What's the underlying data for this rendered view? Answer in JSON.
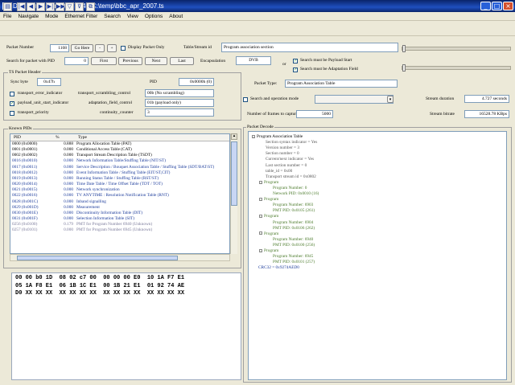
{
  "window": {
    "title": "DVB Translator 2009 V14 - C:\\temp\\bbc_apr_2007.ts",
    "icon_label": "DVB",
    "minimize": "_",
    "maximize": "□",
    "close": "×"
  },
  "menu": [
    "File",
    "Navigate",
    "Mode",
    "Ethernet Filter",
    "Search",
    "View",
    "Options",
    "About"
  ],
  "toolbar": {
    "icons": [
      "open-folder-icon",
      "first-icon",
      "prev-icon",
      "play-icon",
      "next-icon",
      "last-icon",
      "filter-icon",
      "filter-clear-icon",
      "copy-icon"
    ],
    "glyphs": [
      "▤",
      "|◀",
      "◀",
      "▶",
      "▶|",
      "▶▶|",
      "▽",
      "⊽",
      "⧉"
    ]
  },
  "packet_nav": {
    "packet_number_label": "Packet Number",
    "packet_number_value": "1108",
    "go_here_label": "Go Here",
    "minus_label": "-",
    "plus_label": "+",
    "display_packet_only_label": "Display Packet Only",
    "table_stream_id_label": "Table/Stream id",
    "table_stream_id_value": "Program association section",
    "search_pid_label": "Search for packet with PID",
    "search_pid_value": "0",
    "first_label": "First",
    "previous_label": "Previous",
    "next_label": "Next",
    "last_label": "Last",
    "encapsulation_label": "Encapsulation",
    "encapsulation_value": "DVB",
    "or_label": "or",
    "payload_start_label": "Search must be Payload Start",
    "adaptation_field_label": "Search must be Adaptation Field"
  },
  "ts_header": {
    "title": "TS Packet Header",
    "sync_byte_label": "Sync byte",
    "sync_byte_value": "0x47h",
    "pid_label": "PID",
    "pid_value": "0x0000h (0)",
    "transport_error_label": "transport_error_indicator",
    "scrambling_label": "transport_scrambling_control",
    "scrambling_value": "00b (No scrambling)",
    "payload_start_label": "payload_unit_start_indicator",
    "adaptation_label": "adaptation_field_control",
    "adaptation_value": "01b (payload only)",
    "priority_label": "transport_priority",
    "continuity_label": "continuity_counter",
    "continuity_value": "3"
  },
  "packet_type": {
    "label": "Packet Type:",
    "value": "Program Association Table"
  },
  "search_mode": {
    "label": "Search and operation mode",
    "frames_label": "Number of frames to capture",
    "frames_value": "5000",
    "stream_duration_label": "Stream duration",
    "stream_duration_value": "4.727 seconds",
    "stream_bitrate_label": "Stream bitrate",
    "stream_bitrate_value": "16528.78 KBps"
  },
  "known_pids": {
    "title": "Known PIDs",
    "columns": [
      "PID",
      "%",
      "Type"
    ],
    "rows": [
      {
        "pid": "0000 (0x0000)",
        "pct": "0.888",
        "type": "Program Allocation Table (PAT)"
      },
      {
        "pid": "0001 (0x0001)",
        "pct": "0.000",
        "type": "Conditional Access Table (CAT)"
      },
      {
        "pid": "0002 (0x0002)",
        "pct": "0.000",
        "type": "Transport Stream Description Table (TSDT)"
      },
      {
        "pid": "0016 (0x0010)",
        "pct": "0.000",
        "type": "Network Information Table/Stuffing Table (NIT/ST)"
      },
      {
        "pid": "0017 (0x0011)",
        "pct": "0.000",
        "type": "Service Description / Bouquet Association Table / Stuffing Table (SDT/BAT/ST)"
      },
      {
        "pid": "0018 (0x0012)",
        "pct": "0.000",
        "type": "Event Information Table / Stuffing Table (EIT/ST,CIT)"
      },
      {
        "pid": "0019 (0x0013)",
        "pct": "0.000",
        "type": "Running Status Table / Stuffing Table (RST/ST)"
      },
      {
        "pid": "0020 (0x0014)",
        "pct": "0.000",
        "type": "Time Date Table / Time Offset Table (TDT / TOT)"
      },
      {
        "pid": "0021 (0x0015)",
        "pct": "0.000",
        "type": "Network synchronization"
      },
      {
        "pid": "0022 (0x0016)",
        "pct": "0.000",
        "type": "TV ANYTIME : Resolution Notification Table (RNT)"
      },
      {
        "pid": "0028 (0x001C)",
        "pct": "0.000",
        "type": "Inband signalling"
      },
      {
        "pid": "0029 (0x001D)",
        "pct": "0.000",
        "type": "Measurement"
      },
      {
        "pid": "0030 (0x001E)",
        "pct": "0.000",
        "type": "Discontinuity Information Table (DIT)"
      },
      {
        "pid": "0031 (0x001F)",
        "pct": "0.000",
        "type": "Selection Information Table (SIT)"
      },
      {
        "pid": "0256 (0x0100)",
        "pct": "0.179",
        "type": "PMT for Program Number 6940 (Unknown)"
      },
      {
        "pid": "0257 (0x0101)",
        "pct": "0.000",
        "type": "PMT for Program Number 6945 (Unknown)"
      }
    ]
  },
  "hex_dump": {
    "lines": [
      "00 00 b0 1D  08 02 c7 00  00 00 00 E0  10 1A F7 E1",
      "05 1A F8 E1  06 1B 1C E1  00 1B 21 E1  01 92 74 AE",
      "D0 XX XX XX  XX XX XX XX  XX XX XX XX  XX XX XX XX"
    ]
  },
  "packet_decode": {
    "title": "Packet Decode",
    "nodes": [
      {
        "level": 0,
        "text": "Program Association Table",
        "color": "#000000",
        "box": "-"
      },
      {
        "level": 1,
        "text": "Section syntax indicator = Yes",
        "color": "#555555"
      },
      {
        "level": 1,
        "text": "Version number = 3",
        "color": "#555555"
      },
      {
        "level": 1,
        "text": "Section number = 0",
        "color": "#555555"
      },
      {
        "level": 1,
        "text": "Current/next indicator = Yes",
        "color": "#555555"
      },
      {
        "level": 1,
        "text": "Last section number = 0",
        "color": "#555555"
      },
      {
        "level": 1,
        "text": "table_id = 0x00",
        "color": "#555555"
      },
      {
        "level": 1,
        "text": "Transport stream id = 0x0802",
        "color": "#555555"
      },
      {
        "level": 1,
        "text": "Program",
        "color": "#4a7a2a",
        "box": "-"
      },
      {
        "level": 2,
        "text": "Program Number: 0",
        "color": "#4a7a2a"
      },
      {
        "level": 2,
        "text": "Network PID: 0x0010 (16)",
        "color": "#4a7a2a"
      },
      {
        "level": 1,
        "text": "Program",
        "color": "#4a7a2a",
        "box": "-"
      },
      {
        "level": 2,
        "text": "Program Number: 6903",
        "color": "#4a7a2a"
      },
      {
        "level": 2,
        "text": "PMT PID: 0x0105 (261)",
        "color": "#4a7a2a"
      },
      {
        "level": 1,
        "text": "Program",
        "color": "#4a7a2a",
        "box": "-"
      },
      {
        "level": 2,
        "text": "Program Number: 6904",
        "color": "#4a7a2a"
      },
      {
        "level": 2,
        "text": "PMT PID: 0x0106 (262)",
        "color": "#4a7a2a"
      },
      {
        "level": 1,
        "text": "Program",
        "color": "#4a7a2a",
        "box": "-"
      },
      {
        "level": 2,
        "text": "Program Number: 6940",
        "color": "#4a7a2a"
      },
      {
        "level": 2,
        "text": "PMT PID: 0x0100 (256)",
        "color": "#4a7a2a"
      },
      {
        "level": 1,
        "text": "Program",
        "color": "#4a7a2a",
        "box": "-"
      },
      {
        "level": 2,
        "text": "Program Number: 6945",
        "color": "#4a7a2a"
      },
      {
        "level": 2,
        "text": "PMT PID: 0x0101 (257)",
        "color": "#4a7a2a"
      },
      {
        "level": 0,
        "text": "CRC32 = 0x9274AED0",
        "color": "#1a3a9a"
      }
    ]
  },
  "colors": {
    "pid_row_blue": "#1a3a9a",
    "pid_row_black": "#000000",
    "pid_row_gray": "#7a7a9a",
    "selection": "#316ac5"
  }
}
